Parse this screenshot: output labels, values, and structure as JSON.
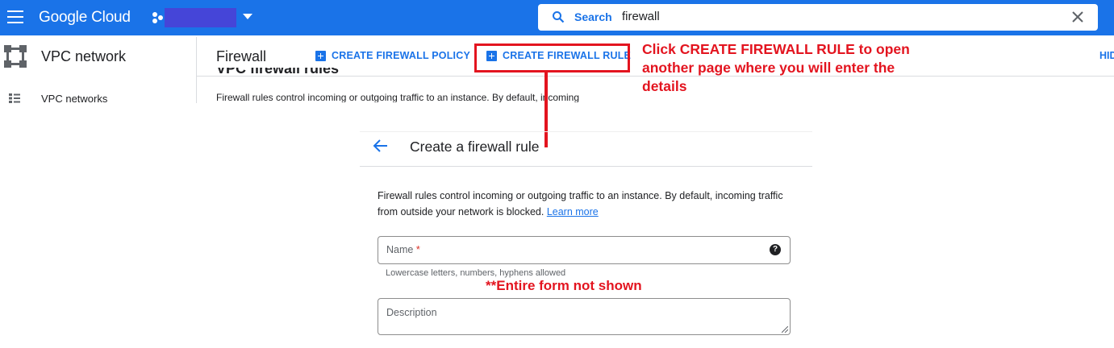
{
  "header": {
    "logo": "Google Cloud",
    "search": {
      "label": "Search",
      "value": "firewall"
    }
  },
  "product": {
    "name": "VPC network"
  },
  "page": {
    "title": "Firewall",
    "actions": {
      "create_policy": "CREATE FIREWALL POLICY",
      "create_rule": "CREATE FIREWALL RULE",
      "hide": "HID"
    },
    "cut_heading": "VPC firewall rules",
    "description": "Firewall rules control incoming or outgoing traffic to an instance. By default, incoming"
  },
  "sidebar": {
    "items": [
      {
        "label": "VPC networks",
        "icon": "vpc-networks-icon"
      }
    ]
  },
  "annotations": {
    "callout": "Click CREATE FIREWALL RULE to open another page where you will enter the details",
    "form_note": "**Entire form not shown",
    "color": "#e3141f"
  },
  "create_panel": {
    "title": "Create a firewall rule",
    "description": "Firewall rules control incoming or outgoing traffic to an instance. By default, incoming traffic from outside your network is blocked.",
    "learn_more": "Learn more",
    "name_field": {
      "label": "Name",
      "required_mark": "*",
      "hint": "Lowercase letters, numbers, hyphens allowed"
    },
    "description_field": {
      "label": "Description"
    }
  },
  "colors": {
    "brand": "#1a73e8",
    "annotation": "#e3141f"
  }
}
